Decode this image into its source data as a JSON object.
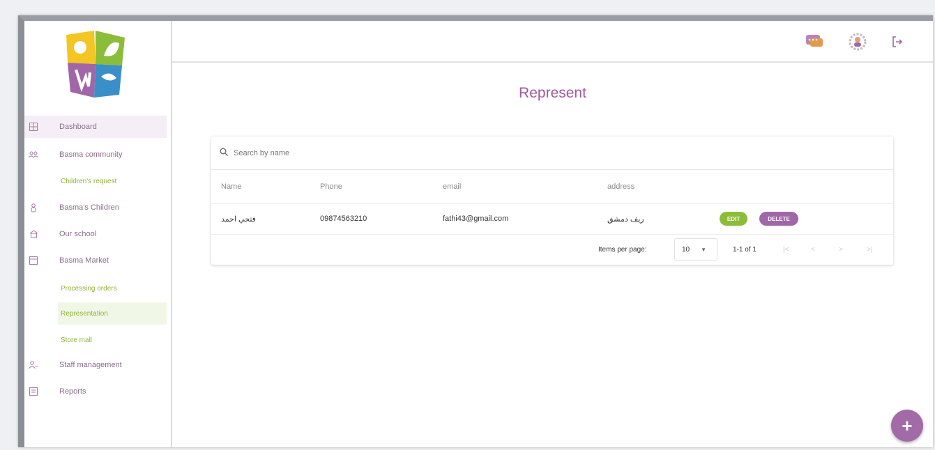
{
  "sidebar": {
    "items": [
      {
        "label": "Dashboard",
        "icon": "dashboard-icon",
        "active": true,
        "sub": false
      },
      {
        "label": "Basma community",
        "icon": "community-icon",
        "active": false,
        "sub": false
      },
      {
        "label": "Children's request",
        "icon": "",
        "active": false,
        "sub": true
      },
      {
        "label": "Basma's Children",
        "icon": "children-icon",
        "active": false,
        "sub": false
      },
      {
        "label": "Our school",
        "icon": "school-icon",
        "active": false,
        "sub": false
      },
      {
        "label": "Basma Market",
        "icon": "market-icon",
        "active": false,
        "sub": false
      },
      {
        "label": "Processing orders",
        "icon": "",
        "active": false,
        "sub": true
      },
      {
        "label": "Representation",
        "icon": "",
        "active": true,
        "sub": true
      },
      {
        "label": "Store mall",
        "icon": "",
        "active": false,
        "sub": true
      },
      {
        "label": "Staff management",
        "icon": "staff-icon",
        "active": false,
        "sub": false
      },
      {
        "label": "Reports",
        "icon": "reports-icon",
        "active": false,
        "sub": false
      }
    ]
  },
  "topbar": {
    "chat_icon": "chat-icon",
    "profile_icon": "profile-gear-icon",
    "logout_icon": "logout-icon"
  },
  "page": {
    "title": "Represent"
  },
  "search": {
    "placeholder": "Search by name"
  },
  "table": {
    "headers": [
      "Name",
      "Phone",
      "email",
      "address"
    ],
    "rows": [
      {
        "name": "فتحي احمد",
        "phone": "09874563210",
        "email": "fathi43@gmail.com",
        "address": "ريف دمشق",
        "edit_label": "EDIT",
        "delete_label": "DELETE"
      }
    ]
  },
  "pagination": {
    "items_per_page_label": "Items per page:",
    "items_per_page_value": "10",
    "range_label": "1-1 of 1"
  },
  "fab": {
    "label": "+"
  },
  "colors": {
    "accent_purple": "#a2579e",
    "accent_green": "#8bbd3a"
  }
}
